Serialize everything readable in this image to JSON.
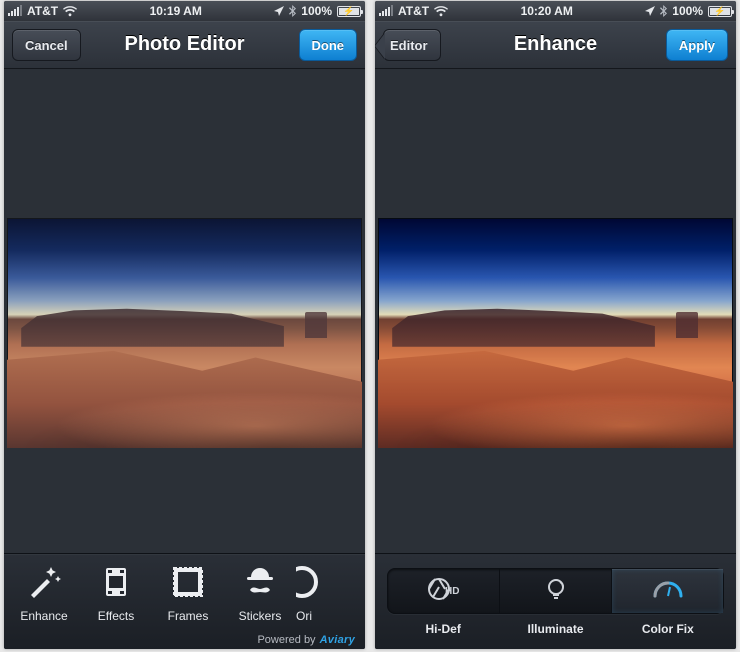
{
  "screens": {
    "editor": {
      "status": {
        "carrier": "AT&T",
        "time": "10:19 AM",
        "battery": "100%"
      },
      "nav": {
        "leftLabel": "Cancel",
        "title": "Photo Editor",
        "rightLabel": "Done"
      },
      "tools": {
        "items": [
          {
            "label": "Enhance"
          },
          {
            "label": "Effects"
          },
          {
            "label": "Frames"
          },
          {
            "label": "Stickers"
          },
          {
            "label": "Ori"
          }
        ]
      },
      "powered": {
        "prefix": "Powered by",
        "brand": "Aviary"
      }
    },
    "enhance": {
      "status": {
        "carrier": "AT&T",
        "time": "10:20 AM",
        "battery": "100%"
      },
      "nav": {
        "backLabel": "Editor",
        "title": "Enhance",
        "rightLabel": "Apply"
      },
      "segments": {
        "items": [
          {
            "label": "Hi-Def"
          },
          {
            "label": "Illuminate"
          },
          {
            "label": "Color Fix"
          }
        ],
        "activeIndex": 2
      }
    }
  }
}
